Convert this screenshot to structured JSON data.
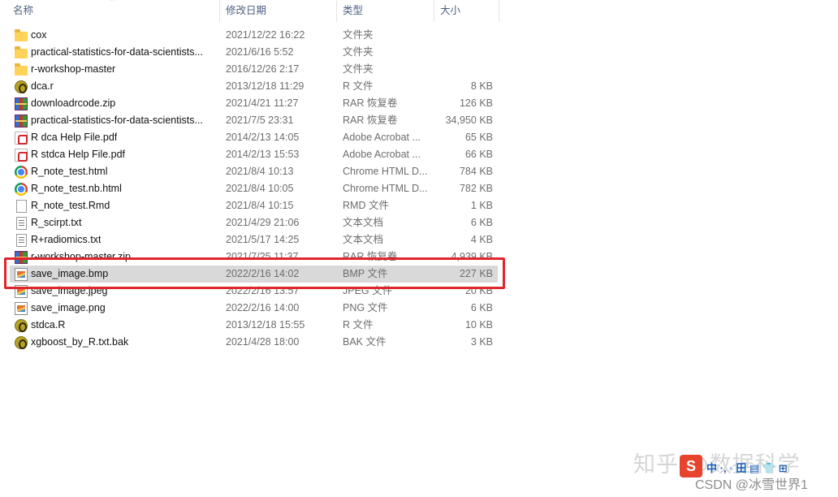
{
  "columns": {
    "name": "名称",
    "modified": "修改日期",
    "type": "类型",
    "size": "大小"
  },
  "sort_indicator": "^",
  "files": [
    {
      "name": "cox",
      "date": "2021/12/22 16:22",
      "type": "文件夹",
      "size": "",
      "icon": "folder-icon"
    },
    {
      "name": "practical-statistics-for-data-scientists...",
      "date": "2021/6/16 5:52",
      "type": "文件夹",
      "size": "",
      "icon": "folder-icon"
    },
    {
      "name": "r-workshop-master",
      "date": "2016/12/26 2:17",
      "type": "文件夹",
      "size": "",
      "icon": "folder-icon"
    },
    {
      "name": "dca.r",
      "date": "2013/12/18 11:29",
      "type": "R 文件",
      "size": "8 KB",
      "icon": "r-file-icon"
    },
    {
      "name": "downloadrcode.zip",
      "date": "2021/4/21 11:27",
      "type": "RAR 恢复卷",
      "size": "126 KB",
      "icon": "rar-archive-icon"
    },
    {
      "name": "practical-statistics-for-data-scientists...",
      "date": "2021/7/5 23:31",
      "type": "RAR 恢复卷",
      "size": "34,950 KB",
      "icon": "rar-archive-icon"
    },
    {
      "name": "R dca Help File.pdf",
      "date": "2014/2/13 14:05",
      "type": "Adobe Acrobat ...",
      "size": "65 KB",
      "icon": "pdf-icon"
    },
    {
      "name": "R stdca Help File.pdf",
      "date": "2014/2/13 15:53",
      "type": "Adobe Acrobat ...",
      "size": "66 KB",
      "icon": "pdf-icon"
    },
    {
      "name": "R_note_test.html",
      "date": "2021/8/4 10:13",
      "type": "Chrome HTML D...",
      "size": "784 KB",
      "icon": "chrome-icon"
    },
    {
      "name": "R_note_test.nb.html",
      "date": "2021/8/4 10:05",
      "type": "Chrome HTML D...",
      "size": "782 KB",
      "icon": "chrome-icon"
    },
    {
      "name": "R_note_test.Rmd",
      "date": "2021/8/4 10:15",
      "type": "RMD 文件",
      "size": "1 KB",
      "icon": "blank-document-icon"
    },
    {
      "name": "R_scirpt.txt",
      "date": "2021/4/29 21:06",
      "type": "文本文档",
      "size": "6 KB",
      "icon": "text-document-icon"
    },
    {
      "name": "R+radiomics.txt",
      "date": "2021/5/17 14:25",
      "type": "文本文档",
      "size": "4 KB",
      "icon": "text-document-icon"
    },
    {
      "name": "r-workshop-master.zip",
      "date": "2021/7/25 11:37",
      "type": "RAR 恢复卷",
      "size": "4,939 KB",
      "icon": "rar-archive-icon"
    },
    {
      "name": "save_image.bmp",
      "date": "2022/2/16 14:02",
      "type": "BMP 文件",
      "size": "227 KB",
      "icon": "image-file-icon",
      "selected": true
    },
    {
      "name": "save_image.jpeg",
      "date": "2022/2/16 13:57",
      "type": "JPEG 文件",
      "size": "20 KB",
      "icon": "image-file-icon"
    },
    {
      "name": "save_image.png",
      "date": "2022/2/16 14:00",
      "type": "PNG 文件",
      "size": "6 KB",
      "icon": "image-file-icon"
    },
    {
      "name": "stdca.R",
      "date": "2013/12/18 15:55",
      "type": "R 文件",
      "size": "10 KB",
      "icon": "r-file-icon"
    },
    {
      "name": "xgboost_by_R.txt.bak",
      "date": "2021/4/28 18:00",
      "type": "BAK 文件",
      "size": "3 KB",
      "icon": "r-file-icon"
    }
  ],
  "watermark": {
    "zhihu": "知乎 @数据科学",
    "s_logo": "S",
    "tray": "中 ·, ◦ 田 ▤ 👕 ⊞",
    "csdn": "CSDN @冰雪世界1"
  }
}
